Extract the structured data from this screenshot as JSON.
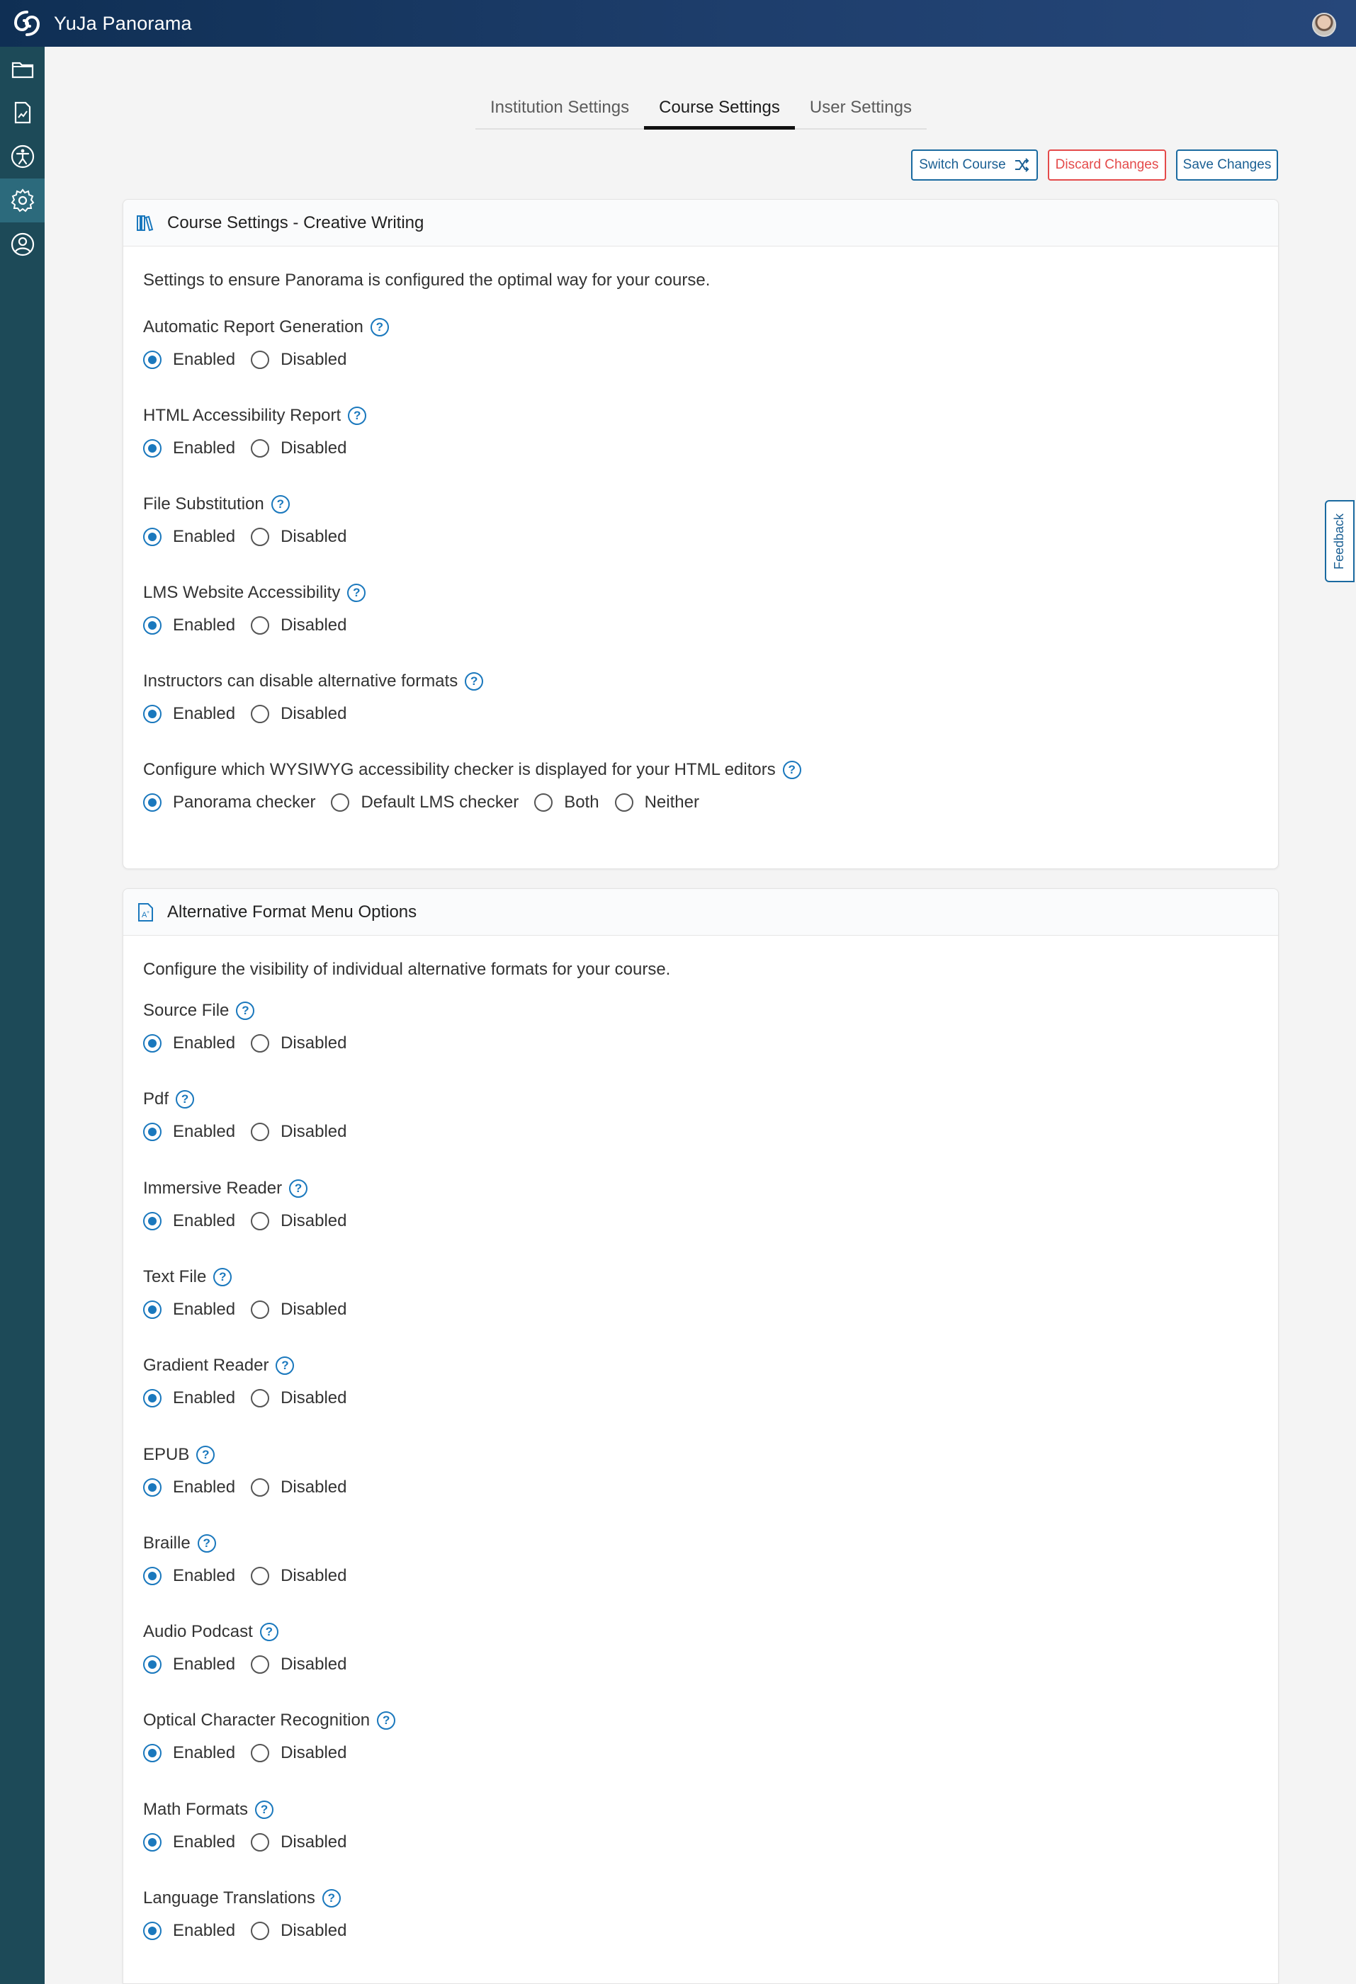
{
  "app": {
    "title": "YuJa Panorama"
  },
  "colors": {
    "topbar": "#1e3e6c",
    "sidebar": "#1d4a58",
    "accent": "#1a78bd",
    "danger": "#e44a4a"
  },
  "sidebar": {
    "items": [
      {
        "icon": "folder-icon"
      },
      {
        "icon": "report-icon"
      },
      {
        "icon": "accessibility-icon"
      },
      {
        "icon": "gear-icon",
        "active": true
      },
      {
        "icon": "user-circle-icon"
      }
    ]
  },
  "tabs": [
    {
      "label": "Institution Settings"
    },
    {
      "label": "Course Settings",
      "active": true
    },
    {
      "label": "User Settings"
    }
  ],
  "actions": {
    "switch_course": "Switch Course",
    "discard_changes": "Discard Changes",
    "save_changes": "Save Changes"
  },
  "course_settings": {
    "title": "Course Settings - Creative Writing",
    "description": "Settings to ensure Panorama is configured the optimal way for your course.",
    "settings": [
      {
        "label": "Automatic Report Generation",
        "options": [
          "Enabled",
          "Disabled"
        ],
        "selected": "Enabled"
      },
      {
        "label": "HTML Accessibility Report",
        "options": [
          "Enabled",
          "Disabled"
        ],
        "selected": "Enabled"
      },
      {
        "label": "File Substitution",
        "options": [
          "Enabled",
          "Disabled"
        ],
        "selected": "Enabled"
      },
      {
        "label": "LMS Website Accessibility",
        "options": [
          "Enabled",
          "Disabled"
        ],
        "selected": "Enabled"
      },
      {
        "label": "Instructors can disable alternative formats",
        "options": [
          "Enabled",
          "Disabled"
        ],
        "selected": "Enabled"
      },
      {
        "label": "Configure which WYSIWYG accessibility checker is displayed for your HTML editors",
        "options": [
          "Panorama checker",
          "Default LMS checker",
          "Both",
          "Neither"
        ],
        "selected": "Panorama checker"
      }
    ]
  },
  "alt_formats": {
    "title": "Alternative Format Menu Options",
    "description": "Configure the visibility of individual alternative formats for your course.",
    "settings": [
      {
        "label": "Source File",
        "options": [
          "Enabled",
          "Disabled"
        ],
        "selected": "Enabled"
      },
      {
        "label": "Pdf",
        "options": [
          "Enabled",
          "Disabled"
        ],
        "selected": "Enabled"
      },
      {
        "label": "Immersive Reader",
        "options": [
          "Enabled",
          "Disabled"
        ],
        "selected": "Enabled"
      },
      {
        "label": "Text File",
        "options": [
          "Enabled",
          "Disabled"
        ],
        "selected": "Enabled"
      },
      {
        "label": "Gradient Reader",
        "options": [
          "Enabled",
          "Disabled"
        ],
        "selected": "Enabled"
      },
      {
        "label": "EPUB",
        "options": [
          "Enabled",
          "Disabled"
        ],
        "selected": "Enabled"
      },
      {
        "label": "Braille",
        "options": [
          "Enabled",
          "Disabled"
        ],
        "selected": "Enabled"
      },
      {
        "label": "Audio Podcast",
        "options": [
          "Enabled",
          "Disabled"
        ],
        "selected": "Enabled"
      },
      {
        "label": "Optical Character Recognition",
        "options": [
          "Enabled",
          "Disabled"
        ],
        "selected": "Enabled"
      },
      {
        "label": "Math Formats",
        "options": [
          "Enabled",
          "Disabled"
        ],
        "selected": "Enabled"
      },
      {
        "label": "Language Translations",
        "options": [
          "Enabled",
          "Disabled"
        ],
        "selected": "Enabled"
      }
    ]
  },
  "feedback": {
    "label": "Feedback"
  }
}
